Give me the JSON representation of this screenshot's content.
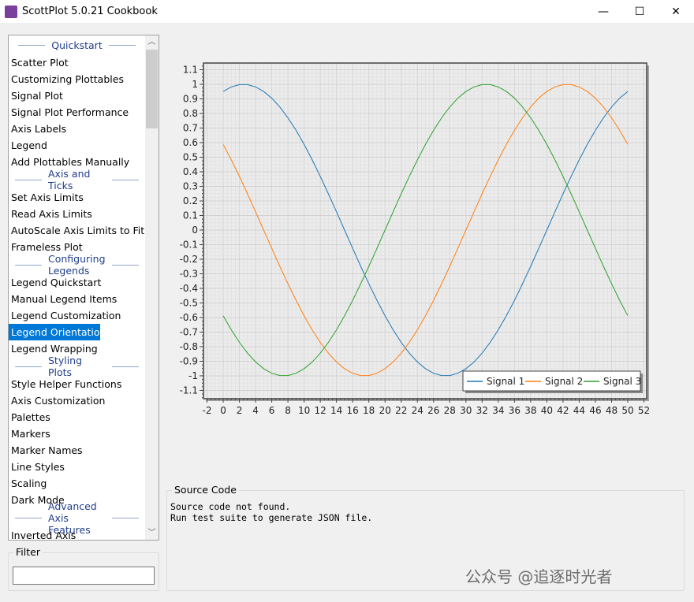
{
  "window": {
    "title": "ScottPlot 5.0.21 Cookbook",
    "minimize": "—",
    "maximize": "☐",
    "close": "✕"
  },
  "sidebar": {
    "entries": [
      {
        "type": "group",
        "label": "Quickstart"
      },
      {
        "type": "item",
        "label": "Scatter Plot"
      },
      {
        "type": "item",
        "label": "Customizing Plottables"
      },
      {
        "type": "item",
        "label": "Signal Plot"
      },
      {
        "type": "item",
        "label": "Signal Plot Performance"
      },
      {
        "type": "item",
        "label": "Axis Labels"
      },
      {
        "type": "item",
        "label": "Legend"
      },
      {
        "type": "item",
        "label": "Add Plottables Manually"
      },
      {
        "type": "group",
        "label": "Axis and Ticks"
      },
      {
        "type": "item",
        "label": "Set Axis Limits"
      },
      {
        "type": "item",
        "label": "Read Axis Limits"
      },
      {
        "type": "item",
        "label": "AutoScale Axis Limits to Fit Data"
      },
      {
        "type": "item",
        "label": "Frameless Plot"
      },
      {
        "type": "group",
        "label": "Configuring Legends"
      },
      {
        "type": "item",
        "label": "Legend Quickstart"
      },
      {
        "type": "item",
        "label": "Manual Legend Items"
      },
      {
        "type": "item",
        "label": "Legend Customization"
      },
      {
        "type": "item",
        "label": "Legend Orientation",
        "selected": true
      },
      {
        "type": "item",
        "label": "Legend Wrapping"
      },
      {
        "type": "group",
        "label": "Styling Plots"
      },
      {
        "type": "item",
        "label": "Style Helper Functions"
      },
      {
        "type": "item",
        "label": "Axis Customization"
      },
      {
        "type": "item",
        "label": "Palettes"
      },
      {
        "type": "item",
        "label": "Markers"
      },
      {
        "type": "item",
        "label": "Marker Names"
      },
      {
        "type": "item",
        "label": "Line Styles"
      },
      {
        "type": "item",
        "label": "Scaling"
      },
      {
        "type": "item",
        "label": "Dark Mode"
      },
      {
        "type": "group",
        "label": "Advanced Axis Features"
      },
      {
        "type": "item",
        "label": "Inverted Axis"
      }
    ]
  },
  "filter": {
    "label": "Filter",
    "value": ""
  },
  "source": {
    "label": "Source Code",
    "text": "Source code not found.\nRun test suite to generate JSON file."
  },
  "watermark": "公众号 @追逐时光者",
  "chart_data": {
    "type": "line",
    "title": "",
    "xlabel": "",
    "ylabel": "",
    "xlim": [
      -2.44,
      52.34
    ],
    "ylim": [
      -1.157,
      1.146
    ],
    "xticks": [
      -2,
      0,
      2,
      4,
      6,
      8,
      10,
      12,
      14,
      16,
      18,
      20,
      22,
      24,
      26,
      28,
      30,
      32,
      34,
      36,
      38,
      40,
      42,
      44,
      46,
      48,
      50,
      52
    ],
    "yticks": [
      1.1,
      1,
      0.9,
      0.8,
      0.7,
      0.6,
      0.5,
      0.4,
      0.3,
      0.2,
      0.1,
      0,
      -0.1,
      -0.2,
      -0.3,
      -0.4,
      -0.5,
      -0.6,
      -0.7,
      -0.8,
      -0.9,
      -1,
      -1.1
    ],
    "grid": true,
    "legend": {
      "placement": "bottom-right",
      "orientation": "horizontal"
    },
    "x": {
      "start": 0,
      "end": 50,
      "step": 1
    },
    "series": [
      {
        "name": "Signal 1",
        "color": "#1f77b4",
        "function": "sin(2πx/50 + phase)",
        "phase_pi": 0.4
      },
      {
        "name": "Signal 2",
        "color": "#ff7f0e",
        "function": "sin(2πx/50 + phase)",
        "phase_pi": 0.8
      },
      {
        "name": "Signal 3",
        "color": "#2ca02c",
        "function": "sin(2πx/50 + phase)",
        "phase_pi": 1.2
      }
    ]
  }
}
